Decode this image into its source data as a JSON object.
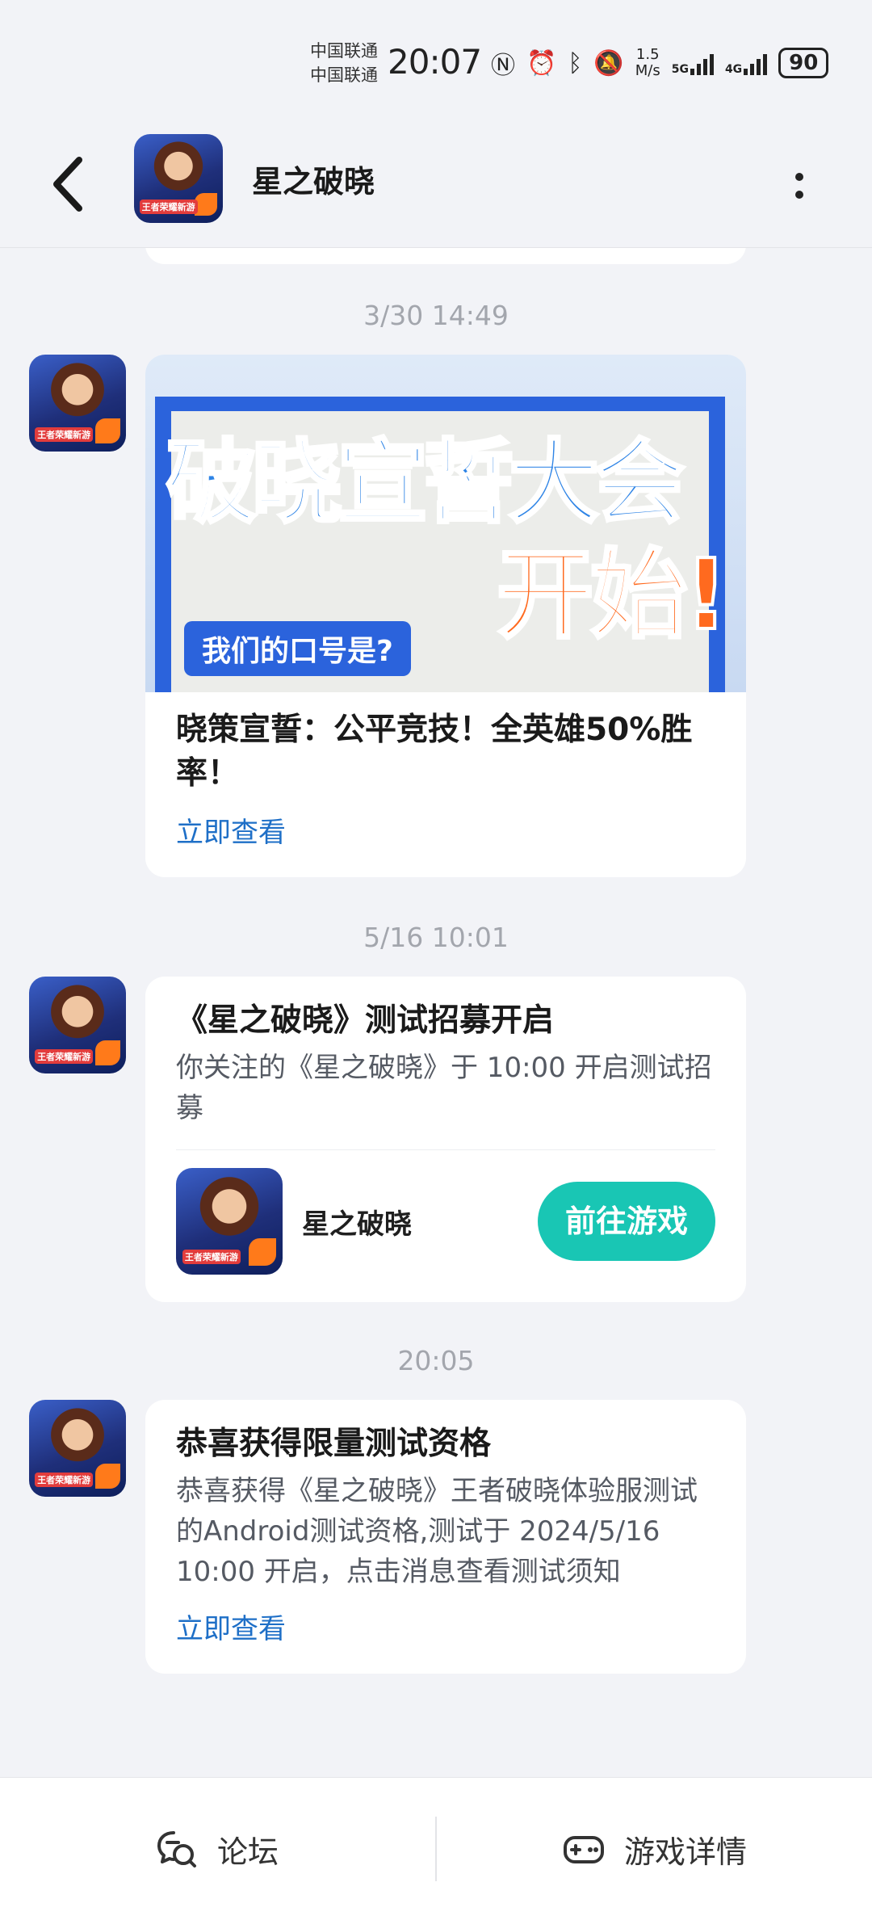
{
  "status_bar": {
    "carrier_1": "中国联通",
    "carrier_2": "中国联通",
    "time": "20:07",
    "net_speed_value": "1.5",
    "net_speed_unit": "M/s",
    "sim1_type": "5G",
    "sim2_type": "4G",
    "battery": "90",
    "icons": [
      "nfc-icon",
      "alarm-icon",
      "bluetooth-icon",
      "mute-icon",
      "signal-icon",
      "battery-icon"
    ]
  },
  "header": {
    "title": "星之破晓",
    "icon_badge": "王者荣耀新游"
  },
  "messages": [
    {
      "timestamp": "3/30  14:49",
      "banner": {
        "line1": "破晓宣誓大会",
        "line2": "开始!",
        "pill": "我们的口号是?"
      },
      "title": "晓策宣誓：公平竞技！全英雄50%胜率！",
      "link": "立即查看"
    },
    {
      "timestamp": "5/16  10:01",
      "title": "《星之破晓》测试招募开启",
      "description": "你关注的《星之破晓》于 10:00 开启测试招募",
      "game_name": "星之破晓",
      "button": "前往游戏"
    },
    {
      "timestamp": "20:05",
      "title": "恭喜获得限量测试资格",
      "description": "恭喜获得《星之破晓》王者破晓体验服测试的Android测试资格,测试于 2024/5/16 10:00 开启，点击消息查看测试须知",
      "link": "立即查看"
    }
  ],
  "bottom_bar": {
    "forum_label": "论坛",
    "details_label": "游戏详情"
  },
  "colors": {
    "accent_button": "#19c6b4",
    "link": "#1e6fc7",
    "background": "#f2f3f7"
  }
}
